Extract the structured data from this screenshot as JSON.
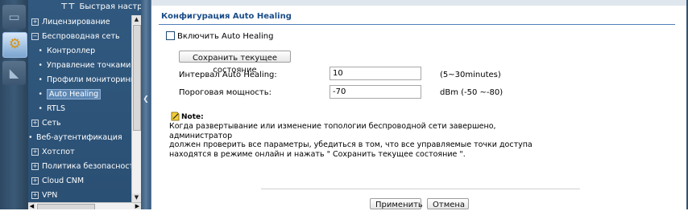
{
  "sidebar": {
    "title": "Быстрая настройка",
    "items": [
      {
        "label": "Лицензирование",
        "type": "plus"
      },
      {
        "label": "Беспроводная сеть",
        "type": "minus"
      },
      {
        "label": "Контроллер",
        "type": "child"
      },
      {
        "label": "Управление точками доступа",
        "type": "child"
      },
      {
        "label": "Профили мониторинга",
        "type": "child"
      },
      {
        "label": "Auto Healing",
        "type": "child",
        "active": true
      },
      {
        "label": "RTLS",
        "type": "child"
      },
      {
        "label": "Сеть",
        "type": "plus"
      },
      {
        "label": "Веб-аутентификация",
        "type": "leaf"
      },
      {
        "label": "Хотспот",
        "type": "plus"
      },
      {
        "label": "Политика безопасности",
        "type": "plus"
      },
      {
        "label": "Cloud CNM",
        "type": "plus"
      },
      {
        "label": "VPN",
        "type": "plus"
      }
    ]
  },
  "icons": {
    "rail": [
      "monitor-icon",
      "configuration-gear-icon",
      "maintenance-icon"
    ],
    "note": "note-pencil-icon"
  },
  "page": {
    "title": "Конфигурация Auto Healing",
    "enable_label": "Включить Auto Healing",
    "enable_checked": false,
    "save_state_button": "Сохранить текущее состояние",
    "interval": {
      "label": "Интервал Auto Healing:",
      "value": "10",
      "hint": "(5~30minutes)"
    },
    "power": {
      "label": "Пороговая мощность:",
      "value": "-70",
      "hint": "dBm (-50 ~-80)"
    },
    "note_title": "Note:",
    "note_lines": [
      "Когда развертывание или изменение топологии беспроводной сети завершено, администратор",
      "должен проверить все параметры, убедиться в том, что все управляемые точки доступа",
      "находятся в режиме онлайн и нажать \" Сохранить текущее состояние \"."
    ],
    "apply_button": "Применить",
    "cancel_button": "Отмена"
  },
  "colors": {
    "nav_bg": "#2f5579",
    "title_text": "#1a4c88",
    "active_item": "#5d87b3"
  }
}
